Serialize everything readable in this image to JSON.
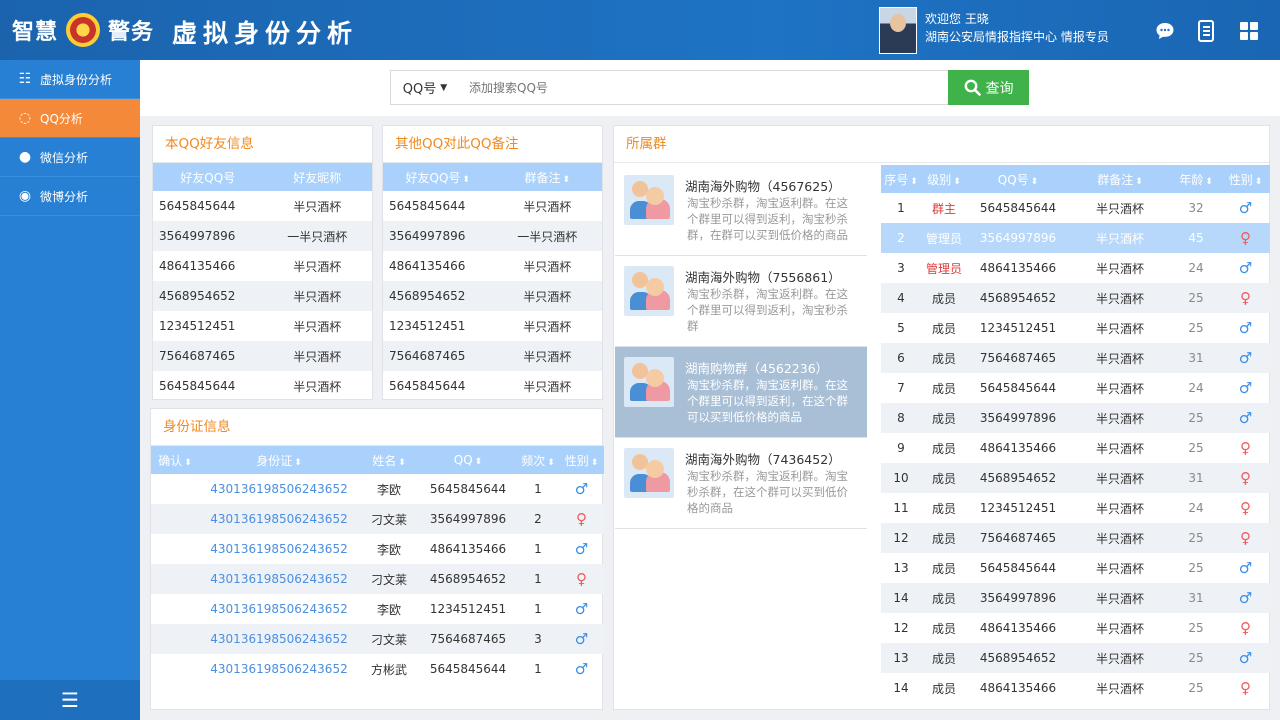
{
  "header": {
    "brand_left": "智慧",
    "brand_right": "警务",
    "app_title": "虚拟身份分析",
    "greeting": "欢迎您 王晓",
    "org": "湖南公安局情报指挥中心 情报专员"
  },
  "sidebar": {
    "items": [
      {
        "label": "虚拟身份分析",
        "icon": "identity-icon"
      },
      {
        "label": "QQ分析",
        "icon": "qq-icon"
      },
      {
        "label": "微信分析",
        "icon": "wechat-icon"
      },
      {
        "label": "微博分析",
        "icon": "weibo-icon"
      }
    ],
    "menu_icon": "☰"
  },
  "search": {
    "type": "QQ号",
    "placeholder": "添加搜索QQ号",
    "button": "查询"
  },
  "friends": {
    "title": "本QQ好友信息",
    "headers": [
      "好友QQ号",
      "好友昵称"
    ],
    "rows": [
      [
        "5645845644",
        "半只酒杯"
      ],
      [
        "3564997896",
        "一半只酒杯"
      ],
      [
        "4864135466",
        "半只酒杯"
      ],
      [
        "4568954652",
        "半只酒杯"
      ],
      [
        "1234512451",
        "半只酒杯"
      ],
      [
        "7564687465",
        "半只酒杯"
      ],
      [
        "5645845644",
        "半只酒杯"
      ]
    ]
  },
  "remarks": {
    "title": "其他QQ对此QQ备注",
    "headers": [
      "好友QQ号",
      "群备注"
    ],
    "rows": [
      [
        "5645845644",
        "半只酒杯"
      ],
      [
        "3564997896",
        "一半只酒杯"
      ],
      [
        "4864135466",
        "半只酒杯"
      ],
      [
        "4568954652",
        "半只酒杯"
      ],
      [
        "1234512451",
        "半只酒杯"
      ],
      [
        "7564687465",
        "半只酒杯"
      ],
      [
        "5645845644",
        "半只酒杯"
      ]
    ]
  },
  "idcards": {
    "title": "身份证信息",
    "headers": [
      "确认",
      "身份证",
      "姓名",
      "QQ",
      "频次",
      "性别"
    ],
    "rows": [
      {
        "id": "430136198506243652",
        "name": "李欧",
        "qq": "5645845644",
        "freq": "1",
        "gender": "male"
      },
      {
        "id": "430136198506243652",
        "name": "刁文莱",
        "qq": "3564997896",
        "freq": "2",
        "gender": "female"
      },
      {
        "id": "430136198506243652",
        "name": "李欧",
        "qq": "4864135466",
        "freq": "1",
        "gender": "male"
      },
      {
        "id": "430136198506243652",
        "name": "刁文莱",
        "qq": "4568954652",
        "freq": "1",
        "gender": "female"
      },
      {
        "id": "430136198506243652",
        "name": "李欧",
        "qq": "1234512451",
        "freq": "1",
        "gender": "male"
      },
      {
        "id": "430136198506243652",
        "name": "刁文莱",
        "qq": "7564687465",
        "freq": "3",
        "gender": "male"
      },
      {
        "id": "430136198506243652",
        "name": "方彬武",
        "qq": "5645845644",
        "freq": "1",
        "gender": "male"
      }
    ]
  },
  "groups_panel": {
    "title": "所属群",
    "groups": [
      {
        "name": "湖南海外购物（4567625）",
        "desc": "淘宝秒杀群，淘宝返利群。在这个群里可以得到返利，淘宝秒杀群，在群可以买到低价格的商品"
      },
      {
        "name": "湖南海外购物（7556861）",
        "desc": "淘宝秒杀群，淘宝返利群。在这个群里可以得到返利，淘宝秒杀群"
      },
      {
        "name": "湖南购物群（4562236）",
        "desc": "淘宝秒杀群，淘宝返利群。在这个群里可以得到返利，在这个群可以买到低价格的商品"
      },
      {
        "name": "湖南海外购物（7436452）",
        "desc": "淘宝秒杀群，淘宝返利群。淘宝秒杀群，在这个群可以买到低价格的商品"
      }
    ],
    "member_headers": [
      "序号",
      "级别",
      "QQ号",
      "群备注",
      "年龄",
      "性别"
    ],
    "members": [
      {
        "no": "1",
        "level": "群主",
        "qq": "5645845644",
        "remark": "半只酒杯",
        "age": "32",
        "gender": "male"
      },
      {
        "no": "2",
        "level": "管理员",
        "qq": "3564997896",
        "remark": "半只酒杯",
        "age": "45",
        "gender": "female"
      },
      {
        "no": "3",
        "level": "管理员",
        "qq": "4864135466",
        "remark": "半只酒杯",
        "age": "24",
        "gender": "male"
      },
      {
        "no": "4",
        "level": "成员",
        "qq": "4568954652",
        "remark": "半只酒杯",
        "age": "25",
        "gender": "female"
      },
      {
        "no": "5",
        "level": "成员",
        "qq": "1234512451",
        "remark": "半只酒杯",
        "age": "25",
        "gender": "male"
      },
      {
        "no": "6",
        "level": "成员",
        "qq": "7564687465",
        "remark": "半只酒杯",
        "age": "31",
        "gender": "male"
      },
      {
        "no": "7",
        "level": "成员",
        "qq": "5645845644",
        "remark": "半只酒杯",
        "age": "24",
        "gender": "male"
      },
      {
        "no": "8",
        "level": "成员",
        "qq": "3564997896",
        "remark": "半只酒杯",
        "age": "25",
        "gender": "male"
      },
      {
        "no": "9",
        "level": "成员",
        "qq": "4864135466",
        "remark": "半只酒杯",
        "age": "25",
        "gender": "female"
      },
      {
        "no": "10",
        "level": "成员",
        "qq": "4568954652",
        "remark": "半只酒杯",
        "age": "31",
        "gender": "female"
      },
      {
        "no": "11",
        "level": "成员",
        "qq": "1234512451",
        "remark": "半只酒杯",
        "age": "24",
        "gender": "female"
      },
      {
        "no": "12",
        "level": "成员",
        "qq": "7564687465",
        "remark": "半只酒杯",
        "age": "25",
        "gender": "female"
      },
      {
        "no": "13",
        "level": "成员",
        "qq": "5645845644",
        "remark": "半只酒杯",
        "age": "25",
        "gender": "male"
      },
      {
        "no": "14",
        "level": "成员",
        "qq": "3564997896",
        "remark": "半只酒杯",
        "age": "31",
        "gender": "male"
      },
      {
        "no": "12",
        "level": "成员",
        "qq": "4864135466",
        "remark": "半只酒杯",
        "age": "25",
        "gender": "female"
      },
      {
        "no": "13",
        "level": "成员",
        "qq": "4568954652",
        "remark": "半只酒杯",
        "age": "25",
        "gender": "male"
      },
      {
        "no": "14",
        "level": "成员",
        "qq": "4864135466",
        "remark": "半只酒杯",
        "age": "25",
        "gender": "female"
      }
    ]
  },
  "colors": {
    "accent": "#2780d4",
    "active": "#f5893a",
    "title": "#f08a1e",
    "table_head": "#a9d1fb",
    "search": "#3fb349"
  }
}
